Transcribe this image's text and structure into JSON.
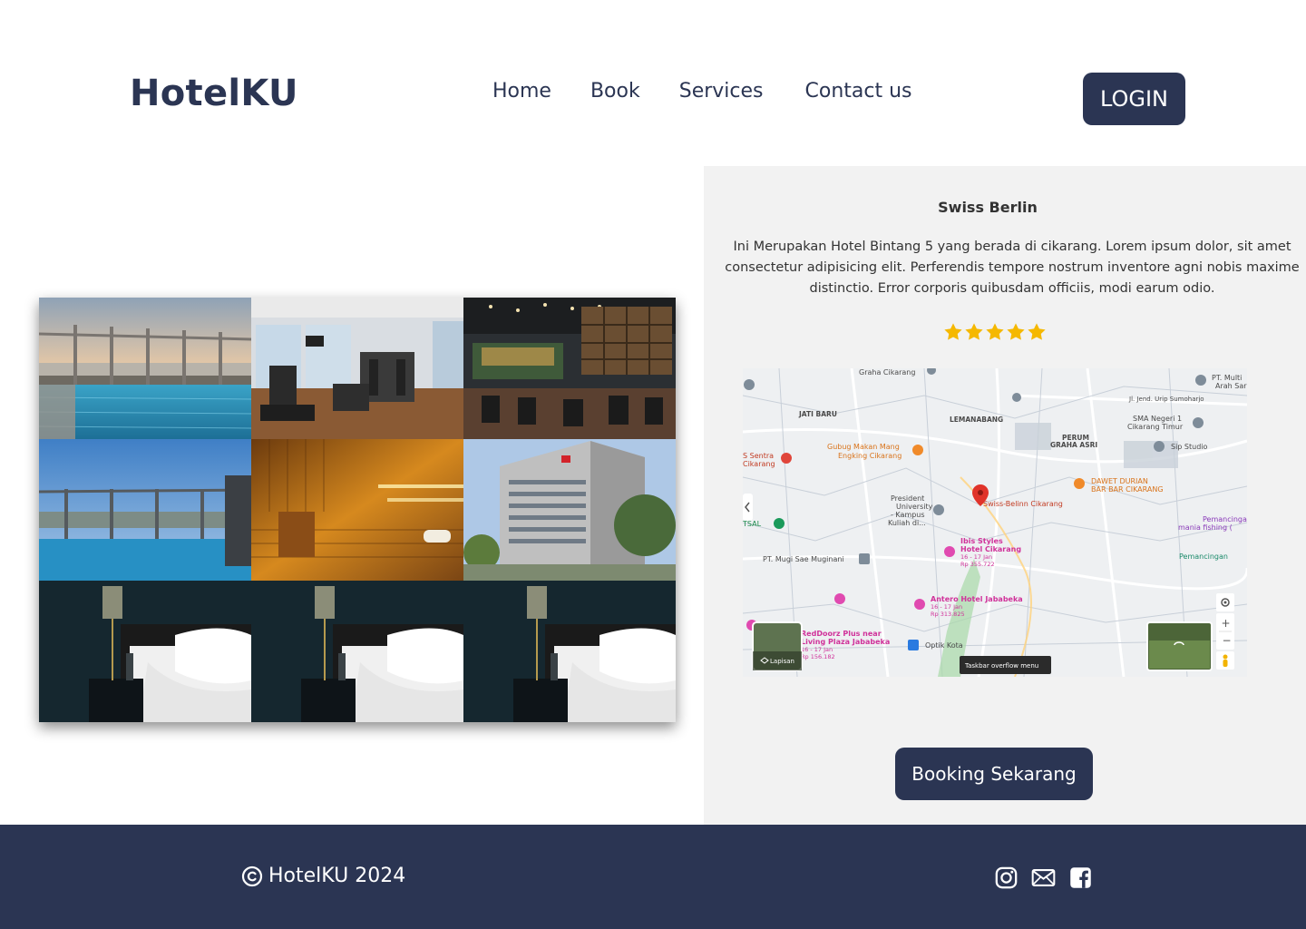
{
  "header": {
    "logo": "HotelKU",
    "nav": [
      "Home",
      "Book",
      "Services",
      "Contact us"
    ],
    "login_label": "LOGIN"
  },
  "hotel": {
    "name": "Swiss Berlin",
    "description": "Ini Merupakan Hotel Bintang 5 yang berada di cikarang. Lorem ipsum dolor, sit amet consectetur adipisicing elit. Perferendis tempore nostrum inventore agni nobis maxime distinctio. Error corporis quibusdam officiis, modi earum odio.",
    "rating": 5,
    "booking_label": "Booking Sekarang"
  },
  "gallery": [
    "rooftop-pool",
    "gym",
    "bar-restaurant",
    "rooftop-pool-day",
    "sauna",
    "hotel-building",
    "bedroom",
    "bedroom",
    "bedroom"
  ],
  "map": {
    "labels": {
      "graha": "Graha Cikarang",
      "jatibaru": "JATI BARU",
      "lemanabang": "LEMANABANG",
      "perum1": "PERUM",
      "perum2": "GRAHA ASRI",
      "sma1": "SMA Negeri 1",
      "sma2": "Cikarang Timur",
      "sip": "Sip Studio",
      "ptmulti1": "PT. Multi",
      "ptmulti2": "Arah Sar",
      "jl": "Jl. Jend. Urip Sumoharjo",
      "sentra1": "S Sentra",
      "sentra2": "Cikarang",
      "gubug1": "Gubug Makan Mang",
      "gubug2": "Engking Cikarang",
      "dawet1": "DAWET DURIAN",
      "dawet2": "BAR BAR CIKARANG",
      "president1": "President",
      "president2": "University",
      "president3": "- Kampus",
      "president4": "Kuliah di...",
      "swiss": "Swiss-Belinn Cikarang",
      "tsal": "TSAL",
      "pemancingan1": "Pemancingan",
      "pemancingan2": "mania fishing (",
      "pemancingan3": "Pemancingan",
      "ptmugi": "PT. Mugi Sae Muginani",
      "ibis1": "Ibis Styles",
      "ibis2": "Hotel Cikarang",
      "ibis3": "16 - 17 Jan",
      "ibis4": "Rp 355.722",
      "antero1": "Antero Hotel Jababeka",
      "antero2": "16 - 17 Jan",
      "antero3": "Rp 313.825",
      "reddoorz1": "RedDoorz Plus near",
      "reddoorz2": "Living Plaza Jababeka",
      "reddoorz3": "16 - 17 Jan",
      "reddoorz4": "Rp 156.182",
      "optik": "Optik Kota",
      "lapisan": "Lapisan",
      "taskbar": "Taskbar overflow menu"
    }
  },
  "footer": {
    "copyright": "HotelKU 2024",
    "social": [
      "instagram-icon",
      "mail-icon",
      "facebook-icon"
    ]
  },
  "colors": {
    "primary": "#2b3553",
    "panel": "#f2f2f2",
    "star": "#f5b800"
  }
}
